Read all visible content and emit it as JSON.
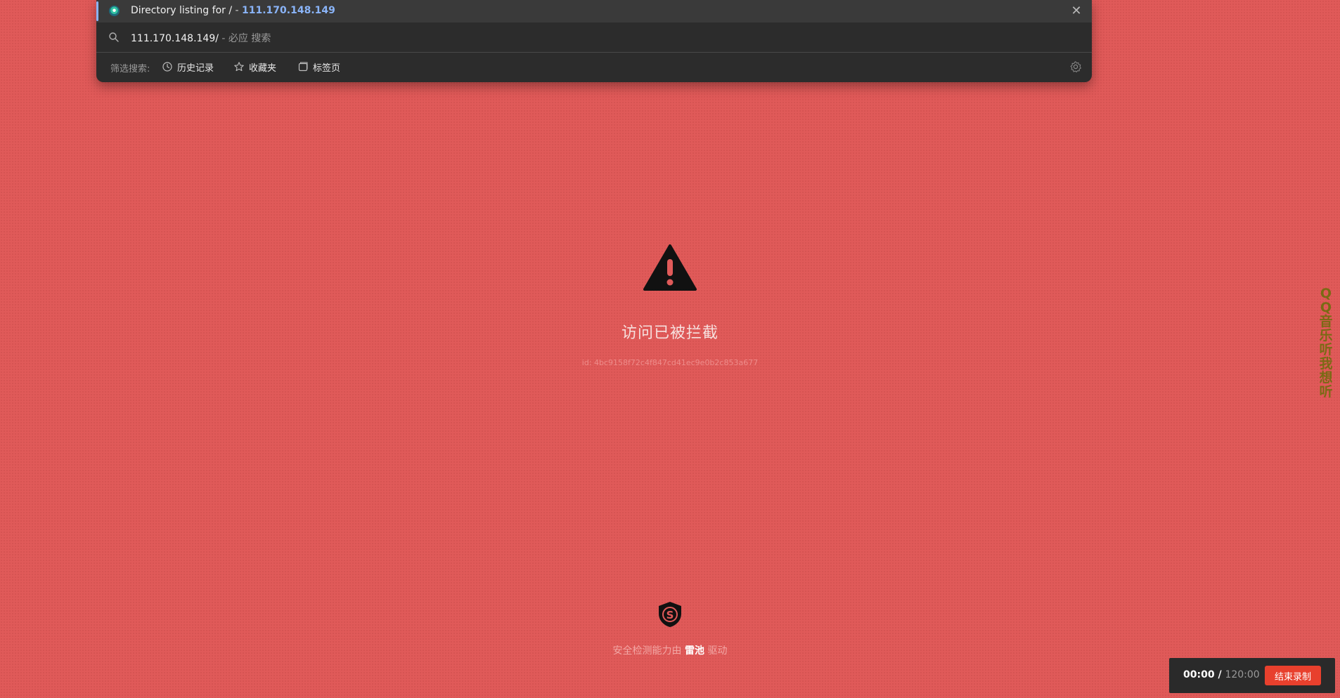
{
  "omnibox": {
    "suggestion": {
      "title": "Directory listing for /",
      "separator": " - ",
      "url": "111.170.148.149"
    },
    "input": {
      "typed": "111.170.148.149/",
      "hint": " - 必应 搜索"
    },
    "filters": {
      "label": "筛选搜索:",
      "history": "历史记录",
      "bookmarks": "收藏夹",
      "tabs": "标签页"
    }
  },
  "blocked_page": {
    "title": "访问已被拦截",
    "request_id": "id: 4bc9158f72c4f847cd41ec9e0b2c853a677",
    "powered_prefix": "安全检测能力由 ",
    "powered_brand": "雷池",
    "powered_suffix": " 驱动"
  },
  "side_text": "QQ音乐 听我想听",
  "recorder": {
    "current": "00:00",
    "separator": " / ",
    "total": "120:00",
    "stop_label": "结束录制"
  },
  "colors": {
    "page_background": "#e05a59",
    "omnibox_background": "#2c2c2c",
    "link_accent": "#8ab4f8",
    "stop_button": "#e8402d"
  },
  "icons": [
    "site-favicon-icon",
    "close-icon",
    "search-icon",
    "history-icon",
    "star-icon",
    "tabs-icon",
    "gear-icon",
    "warning-icon",
    "shield-icon"
  ]
}
